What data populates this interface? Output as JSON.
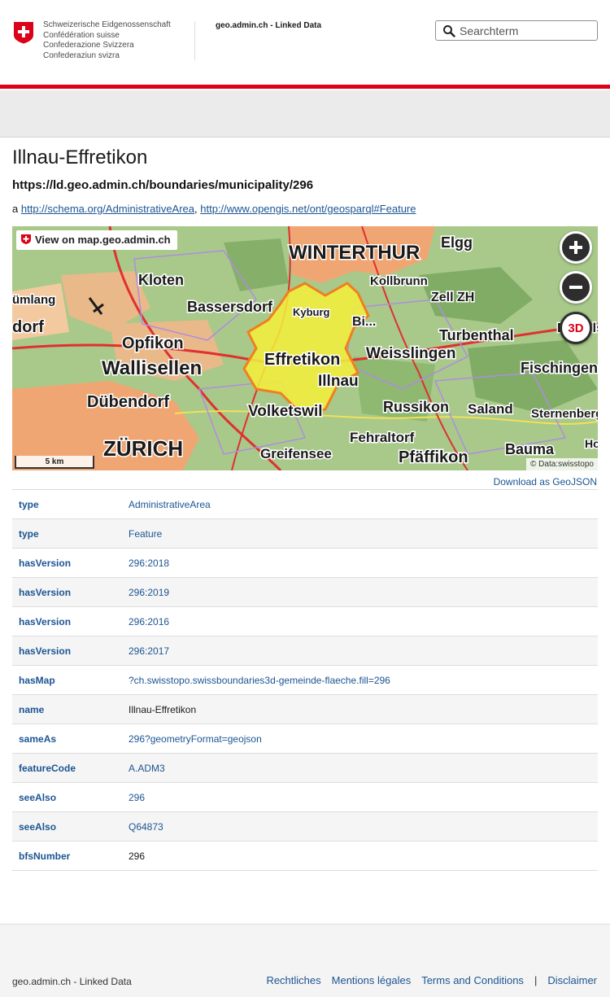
{
  "header": {
    "gov_names": [
      "Schweizerische Eidgenossenschaft",
      "Confédération suisse",
      "Confederazione Svizzera",
      "Confederaziun svizra"
    ],
    "site_title": "geo.admin.ch - Linked Data",
    "search_placeholder": "Searchterm"
  },
  "page": {
    "title": "Illnau-Effretikon",
    "uri": "https://ld.geo.admin.ch/boundaries/municipality/296",
    "type_prefix": "a",
    "type_links": [
      "http://schema.org/AdministrativeArea",
      "http://www.opengis.net/ont/geosparql#Feature"
    ],
    "type_sep": ","
  },
  "map": {
    "view_link": "View on map.geo.admin.ch",
    "zoom_in": "+",
    "zoom_out": "−",
    "btn_3d": "3D",
    "scale_label": "5 km",
    "attribution": "© Data:swisstopo",
    "places": [
      {
        "name": "WINTERTHUR",
        "style": "big"
      },
      {
        "name": "Elgg"
      },
      {
        "name": "Kloten"
      },
      {
        "name": "Kollbrunn"
      },
      {
        "name": "Bassersdorf"
      },
      {
        "name": "Zell ZH"
      },
      {
        "name": "Kyburg"
      },
      {
        "name": "Turbenthal"
      },
      {
        "name": "Opfikon"
      },
      {
        "name": "Effretikon"
      },
      {
        "name": "Weisslingen"
      },
      {
        "name": "Illnau"
      },
      {
        "name": "Wallisellen"
      },
      {
        "name": "Fischingen"
      },
      {
        "name": "Russikon"
      },
      {
        "name": "Volketswil"
      },
      {
        "name": "Dübendorf"
      },
      {
        "name": "ZÜRICH",
        "style": "big"
      },
      {
        "name": "Fehraltorf"
      },
      {
        "name": "Greifensee"
      },
      {
        "name": "Pfäffikon"
      },
      {
        "name": "Bauma"
      },
      {
        "name": "Saland"
      },
      {
        "name": "Sternenberg"
      },
      {
        "name": "Bichelsee"
      },
      {
        "name": "Bi..."
      },
      {
        "name": "dorf"
      },
      {
        "name": "ümlang"
      },
      {
        "name": "Horn"
      }
    ]
  },
  "download_label": "Download as GeoJSON",
  "properties": [
    {
      "pred": "type",
      "obj": "AdministrativeArea",
      "link": true
    },
    {
      "pred": "type",
      "obj": "Feature",
      "link": true
    },
    {
      "pred": "hasVersion",
      "obj": "296:2018",
      "link": true
    },
    {
      "pred": "hasVersion",
      "obj": "296:2019",
      "link": true
    },
    {
      "pred": "hasVersion",
      "obj": "296:2016",
      "link": true
    },
    {
      "pred": "hasVersion",
      "obj": "296:2017",
      "link": true
    },
    {
      "pred": "hasMap",
      "obj": "?ch.swisstopo.swissboundaries3d-gemeinde-flaeche.fill=296",
      "link": true
    },
    {
      "pred": "name",
      "obj": "Illnau-Effretikon",
      "link": false
    },
    {
      "pred": "sameAs",
      "obj": "296?geometryFormat=geojson",
      "link": true
    },
    {
      "pred": "featureCode",
      "obj": "A.ADM3",
      "link": true
    },
    {
      "pred": "seeAlso",
      "obj": "296",
      "link": true
    },
    {
      "pred": "seeAlso",
      "obj": "Q64873",
      "link": true
    },
    {
      "pred": "bfsNumber",
      "obj": "296",
      "link": false
    }
  ],
  "footer": {
    "left": "geo.admin.ch - Linked Data",
    "links": [
      "Rechtliches",
      "Mentions légales",
      "Terms and Conditions",
      "Disclaimer"
    ],
    "sep": "|"
  },
  "colors": {
    "accent_red": "#dc0018",
    "link_blue": "#1c5592",
    "highlight_yellow": "#f5f03a"
  }
}
